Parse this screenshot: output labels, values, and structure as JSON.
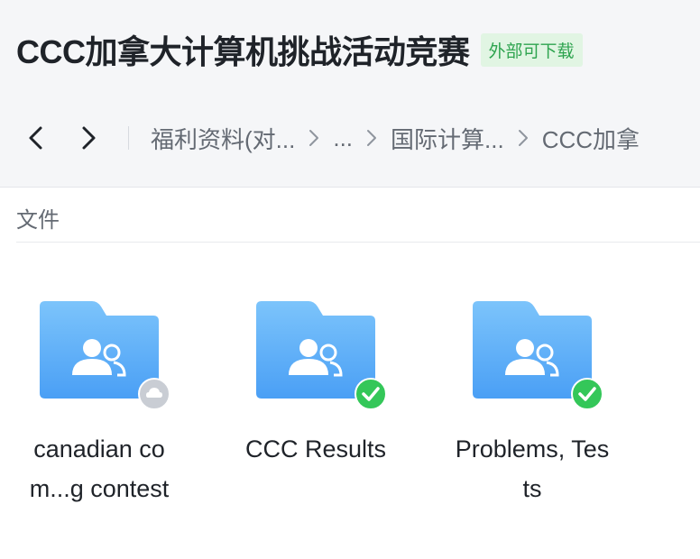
{
  "header": {
    "title": "CCC加拿大计算机挑战活动竞赛",
    "badge": "外部可下载"
  },
  "nav": {
    "back_icon": "chevron-left-icon",
    "forward_icon": "chevron-right-icon",
    "breadcrumbs": [
      {
        "label": "福利资料(对..."
      },
      {
        "label": "..."
      },
      {
        "label": "国际计算..."
      },
      {
        "label": "CCC加拿"
      }
    ]
  },
  "section": {
    "label": "文件"
  },
  "files": [
    {
      "name_line1": "canadian co",
      "name_line2": "m...g contest",
      "icon": "shared-folder-icon",
      "status": "cloud-icon",
      "status_color": "#c9cdd4"
    },
    {
      "name_line1": "CCC Results",
      "name_line2": "",
      "icon": "shared-folder-icon",
      "status": "check-icon",
      "status_color": "#34c759"
    },
    {
      "name_line1": "Problems, Tes",
      "name_line2": "ts",
      "icon": "shared-folder-icon",
      "status": "check-icon",
      "status_color": "#34c759"
    }
  ],
  "colors": {
    "folder_top": "#7cc4fb",
    "folder_bottom": "#4a9ff5",
    "badge_bg": "#e1f5e3",
    "badge_text": "#2ea44f"
  }
}
